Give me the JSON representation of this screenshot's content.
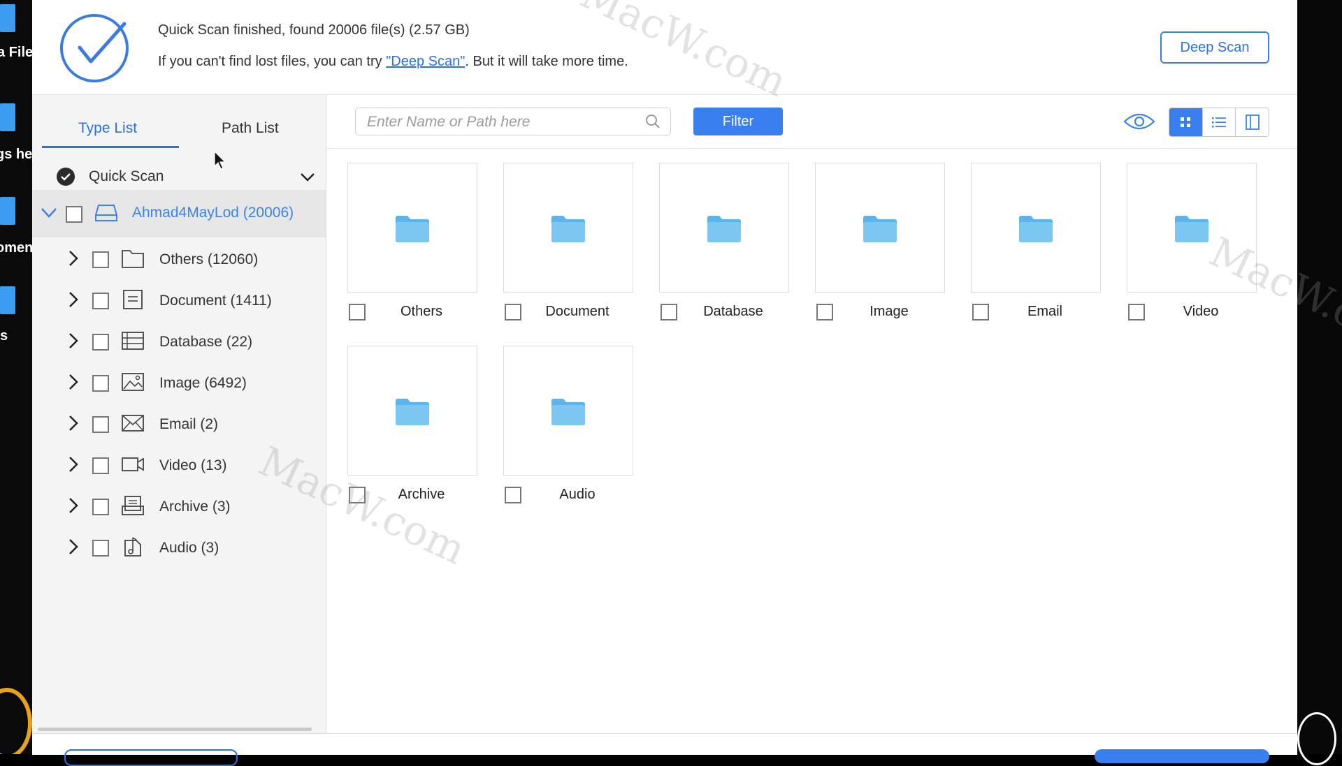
{
  "desktop": {
    "left_labels": [
      "a File",
      "gs he",
      "omen",
      "s"
    ]
  },
  "header": {
    "status_line": "Quick Scan finished, found 20006 file(s) (2.57 GB)",
    "hint_prefix": "If you can't find lost files, you can try ",
    "hint_link": "\"Deep Scan\"",
    "hint_suffix": ". But it will take more time.",
    "deep_scan_button": "Deep Scan"
  },
  "sidebar": {
    "tabs": [
      {
        "label": "Type List",
        "active": true
      },
      {
        "label": "Path List",
        "active": false
      }
    ],
    "scan_label": "Quick Scan",
    "drive_label": "Ahmad4MayLod (20006)",
    "categories": [
      {
        "label": "Others (12060)",
        "icon": "folder-outline-icon"
      },
      {
        "label": "Document (1411)",
        "icon": "document-icon"
      },
      {
        "label": "Database (22)",
        "icon": "database-icon"
      },
      {
        "label": "Image (6492)",
        "icon": "image-icon"
      },
      {
        "label": "Email (2)",
        "icon": "email-icon"
      },
      {
        "label": "Video (13)",
        "icon": "video-icon"
      },
      {
        "label": "Archive (3)",
        "icon": "archive-icon"
      },
      {
        "label": "Audio (3)",
        "icon": "audio-icon"
      }
    ]
  },
  "toolbar": {
    "search_placeholder": "Enter Name or Path here",
    "filter_button": "Filter",
    "active_view": "grid"
  },
  "tiles": [
    {
      "label": "Others"
    },
    {
      "label": "Document"
    },
    {
      "label": "Database"
    },
    {
      "label": "Image"
    },
    {
      "label": "Email"
    },
    {
      "label": "Video"
    },
    {
      "label": "Archive"
    },
    {
      "label": "Audio"
    }
  ],
  "watermark": "MacW.com",
  "colors": {
    "accent": "#3a7ff0",
    "link": "#2a72e0",
    "folder": "#5ab4ee",
    "selected_row": "#e6e6e6"
  }
}
